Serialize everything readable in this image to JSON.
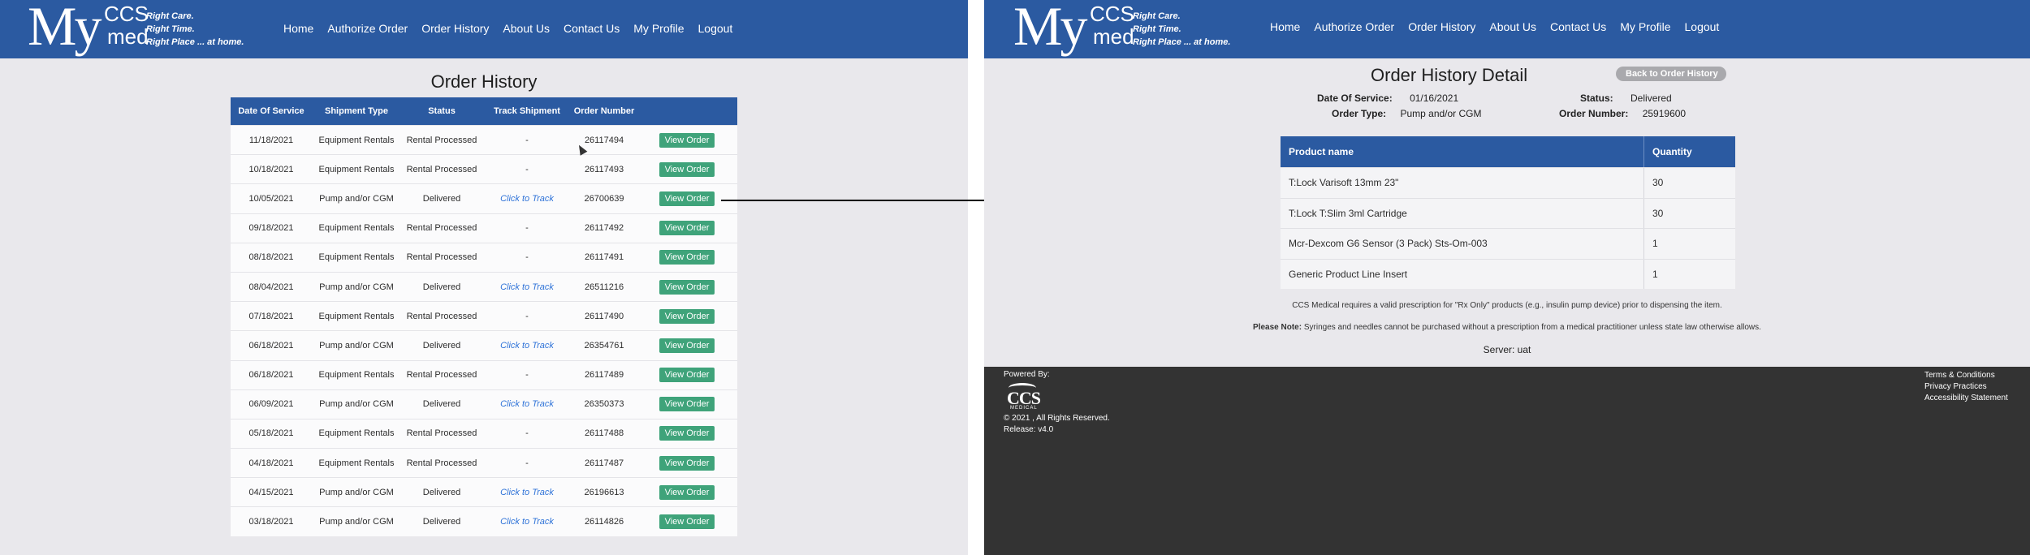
{
  "brand": {
    "my": "My",
    "ccs": "CCS",
    "med": "med",
    "tagline": [
      "Right Care.",
      "Right Time.",
      "Right Place ... at home."
    ]
  },
  "nav": [
    "Home",
    "Authorize Order",
    "Order History",
    "About Us",
    "Contact Us",
    "My Profile",
    "Logout"
  ],
  "order_history": {
    "title": "Order History",
    "columns": [
      "Date Of Service",
      "Shipment Type",
      "Status",
      "Track Shipment",
      "Order Number",
      ""
    ],
    "view_label": "View Order",
    "rows": [
      {
        "date": "11/18/2021",
        "type": "Equipment Rentals",
        "status": "Rental Processed",
        "track": "-",
        "order": "26117494"
      },
      {
        "date": "10/18/2021",
        "type": "Equipment Rentals",
        "status": "Rental Processed",
        "track": "-",
        "order": "26117493"
      },
      {
        "date": "10/05/2021",
        "type": "Pump and/or CGM",
        "status": "Delivered",
        "track": "Click to Track",
        "order": "26700639"
      },
      {
        "date": "09/18/2021",
        "type": "Equipment Rentals",
        "status": "Rental Processed",
        "track": "-",
        "order": "26117492"
      },
      {
        "date": "08/18/2021",
        "type": "Equipment Rentals",
        "status": "Rental Processed",
        "track": "-",
        "order": "26117491"
      },
      {
        "date": "08/04/2021",
        "type": "Pump and/or CGM",
        "status": "Delivered",
        "track": "Click to Track",
        "order": "26511216"
      },
      {
        "date": "07/18/2021",
        "type": "Equipment Rentals",
        "status": "Rental Processed",
        "track": "-",
        "order": "26117490"
      },
      {
        "date": "06/18/2021",
        "type": "Pump and/or CGM",
        "status": "Delivered",
        "track": "Click to Track",
        "order": "26354761"
      },
      {
        "date": "06/18/2021",
        "type": "Equipment Rentals",
        "status": "Rental Processed",
        "track": "-",
        "order": "26117489"
      },
      {
        "date": "06/09/2021",
        "type": "Pump and/or CGM",
        "status": "Delivered",
        "track": "Click to Track",
        "order": "26350373"
      },
      {
        "date": "05/18/2021",
        "type": "Equipment Rentals",
        "status": "Rental Processed",
        "track": "-",
        "order": "26117488"
      },
      {
        "date": "04/18/2021",
        "type": "Equipment Rentals",
        "status": "Rental Processed",
        "track": "-",
        "order": "26117487"
      },
      {
        "date": "04/15/2021",
        "type": "Pump and/or CGM",
        "status": "Delivered",
        "track": "Click to Track",
        "order": "26196613"
      },
      {
        "date": "03/18/2021",
        "type": "Pump and/or CGM",
        "status": "Delivered",
        "track": "Click to Track",
        "order": "26114826"
      }
    ]
  },
  "detail": {
    "title": "Order History Detail",
    "back_label": "Back to Order History",
    "date_label": "Date Of Service:",
    "date_value": "01/16/2021",
    "type_label": "Order Type:",
    "type_value": "Pump and/or CGM",
    "status_label": "Status:",
    "status_value": "Delivered",
    "order_label": "Order Number:",
    "order_value": "25919600",
    "columns": [
      "Product name",
      "Quantity"
    ],
    "products": [
      {
        "name": "T:Lock Varisoft 13mm 23\"",
        "qty": "30"
      },
      {
        "name": "T:Lock T:Slim 3ml Cartridge",
        "qty": "30"
      },
      {
        "name": "Mcr-Dexcom G6 Sensor (3 Pack) Sts-Om-003",
        "qty": "1"
      },
      {
        "name": "Generic Product Line Insert",
        "qty": "1"
      }
    ],
    "note1": "CCS Medical requires a valid prescription for \"Rx Only\" products (e.g., insulin pump device) prior to dispensing the item.",
    "note2_label": "Please Note:",
    "note2_text": " Syringes and needles cannot be purchased without a prescription from a medical practitioner unless state law otherwise allows.",
    "server": "Server: uat"
  },
  "footer": {
    "powered": "Powered By:",
    "logo_ccs": "CCS",
    "logo_med": "MEDICAL",
    "copyright": "© 2021 , All Rights Reserved.",
    "release": "Release: v4.0",
    "links": [
      "Terms & Conditions",
      "Privacy Practices",
      "Accessibility Statement"
    ]
  },
  "colors": {
    "header_blue": "#2b5aa1",
    "button_green": "#3fa37a",
    "link_blue": "#2f73d8",
    "footer_dark": "#333333",
    "page_bg": "#e9e8ec"
  }
}
